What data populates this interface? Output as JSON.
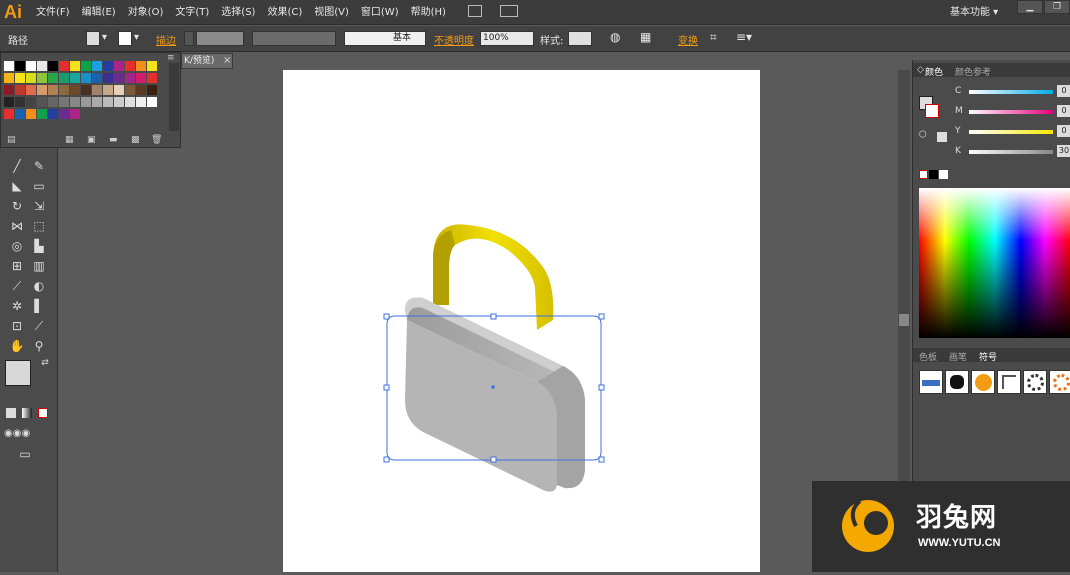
{
  "app": {
    "logo": "Ai"
  },
  "menu": [
    "文件(F)",
    "编辑(E)",
    "对象(O)",
    "文字(T)",
    "选择(S)",
    "效果(C)",
    "视图(V)",
    "窗口(W)",
    "帮助(H)"
  ],
  "workspace": {
    "label": "基本功能"
  },
  "control_bar": {
    "selection_label": "路径",
    "stroke_label": "描边",
    "stroke_profile": "基本",
    "opacity_label": "不透明度",
    "opacity_value": "100%",
    "style_label": "样式:",
    "transform_label": "变换"
  },
  "document": {
    "tab_label": "K/预览)",
    "close": "×"
  },
  "color_panel": {
    "tabs": [
      "颜色",
      "颜色参考"
    ],
    "channels": [
      {
        "name": "C",
        "value": "0",
        "color": "#00aee8"
      },
      {
        "name": "M",
        "value": "0",
        "color": "#e6007e"
      },
      {
        "name": "Y",
        "value": "0",
        "color": "#f5e800"
      },
      {
        "name": "K",
        "value": "30",
        "color": "#888888"
      }
    ]
  },
  "symbols_panel": {
    "tabs": [
      "色板",
      "画笔",
      "符号"
    ]
  },
  "watermark": {
    "name": "羽兔网",
    "url": "WWW.YUTU.CN"
  },
  "colors": {
    "accent": "#f39c12",
    "lock_body": "#b8b8b8",
    "shackle": "#e8d200",
    "selection": "#3b6fe0"
  }
}
